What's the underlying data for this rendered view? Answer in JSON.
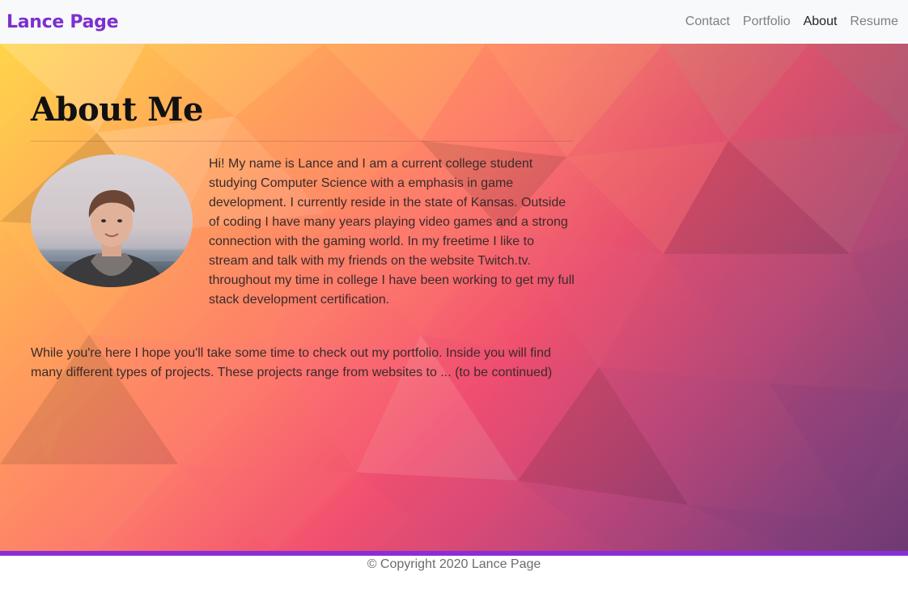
{
  "nav": {
    "brand": "Lance Page",
    "links": [
      {
        "label": "Contact",
        "active": false
      },
      {
        "label": "Portfolio",
        "active": false
      },
      {
        "label": "About",
        "active": true
      },
      {
        "label": "Resume",
        "active": false
      }
    ]
  },
  "about": {
    "title": "About Me",
    "avatar_icon": "profile-photo",
    "bio": "Hi! My name is Lance and I am a current college student studying Computer Science with a emphasis in game development. I currently reside in the state of Kansas. Outside of coding I have many years playing video games and a strong connection with the gaming world. In my freetime I like to stream and talk with my friends on the website Twitch.tv. throughout my time in college I have been working to get my full stack development certification.",
    "more": "While you're here I hope you'll take some time to check out my portfolio. Inside you will find many different types of projects. These projects range from websites to ... (to be continued)"
  },
  "footer": {
    "copyright": "© Copyright 2020 Lance Page"
  },
  "colors": {
    "brand": "#7d2fd0",
    "footer_bar": "#8a2ed6",
    "nav_bg": "#f8f9fa"
  }
}
